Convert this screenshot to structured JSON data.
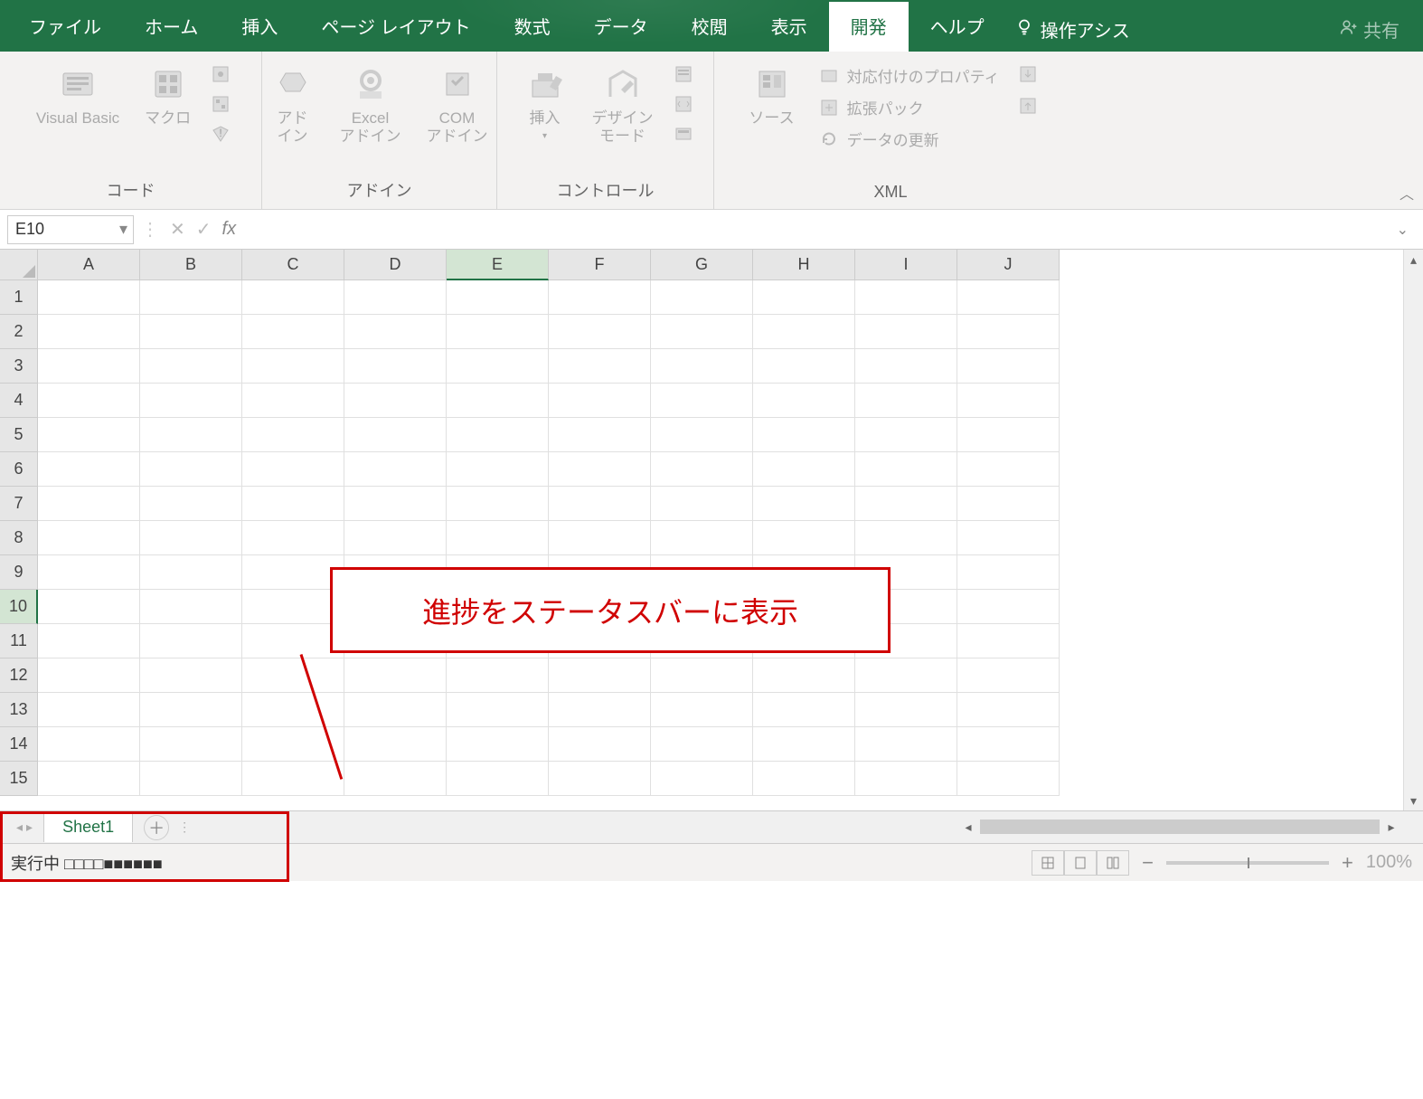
{
  "tabs": {
    "file": "ファイル",
    "home": "ホーム",
    "insert": "挿入",
    "pagelayout": "ページ レイアウト",
    "formulas": "数式",
    "data": "データ",
    "review": "校閲",
    "view": "表示",
    "developer": "開発",
    "help": "ヘルプ",
    "tellme": "操作アシス",
    "share": "共有"
  },
  "ribbon": {
    "code": {
      "label": "コード",
      "vba": "Visual Basic",
      "macro": "マクロ"
    },
    "addins": {
      "label": "アドイン",
      "addin": "アド\nイン",
      "excel": "Excel\nアドイン",
      "com": "COM\nアドイン"
    },
    "controls": {
      "label": "コントロール",
      "insert": "挿入",
      "design": "デザイン\nモード"
    },
    "xml": {
      "label": "XML",
      "source": "ソース",
      "props": "対応付けのプロパティ",
      "expand": "拡張パック",
      "refresh": "データの更新"
    }
  },
  "namebox": "E10",
  "formula": "",
  "columns": [
    "A",
    "B",
    "C",
    "D",
    "E",
    "F",
    "G",
    "H",
    "I",
    "J"
  ],
  "rows": [
    "1",
    "2",
    "3",
    "4",
    "5",
    "6",
    "7",
    "8",
    "9",
    "10",
    "11",
    "12",
    "13",
    "14",
    "15"
  ],
  "selected_col": "E",
  "selected_row": "10",
  "sheet": {
    "name": "Sheet1"
  },
  "status": {
    "text": "実行中   □□□□■■■■■■"
  },
  "callout": {
    "text": "進捗をステータスバーに表示"
  },
  "zoom": "100%"
}
